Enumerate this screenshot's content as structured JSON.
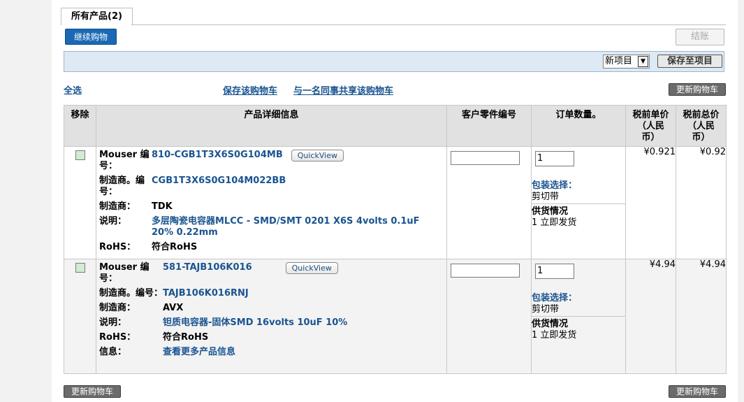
{
  "tab": {
    "label": "所有产品(2)"
  },
  "buttons": {
    "continue_shopping": "继续购物",
    "checkout": "结账",
    "save_project": "保存至项目",
    "update_cart": "更新购物车"
  },
  "project_select": {
    "value": "新项目"
  },
  "links": {
    "select_all": "全选",
    "save_cart": "保存该购物车",
    "share_cart": "与一名同事共享该购物车"
  },
  "table": {
    "headers": {
      "remove": "移除",
      "details": "产品详细信息",
      "customer_part": "客户零件编号",
      "quantity": "订单数量。",
      "unit_price": "税前单价（人民币）",
      "total_price": "税前总价（人民币）"
    },
    "quickview": "QuickView",
    "rows": [
      {
        "mouser_label": "Mouser 编号：",
        "mouser_no": "810-CGB1T3X6S0G104MB",
        "mfr_label": "制造商。编号：",
        "mfr_no": "CGB1T3X6S0G104M022BB",
        "maker_label": "制造商：",
        "maker": "TDK",
        "desc_label": "说明：",
        "desc": "多层陶瓷电容器MLCC - SMD/SMT 0201 X6S 4volts 0.1uF 20% 0.22mm",
        "rohs_label": "RoHS：",
        "rohs": "符合RoHS",
        "qty": "1",
        "pack_label": "包装选择：",
        "pack": "剪切带",
        "stock_label": "供货情况",
        "stock": "1 立即发货",
        "unit": "¥0.921",
        "total": "¥0.92"
      },
      {
        "mouser_label": "Mouser 编号：",
        "mouser_no": "581-TAJB106K016",
        "mfr_label": "制造商。编号：",
        "mfr_no": "TAJB106K016RNJ",
        "maker_label": "制造商：",
        "maker": "AVX",
        "desc_label": "说明：",
        "desc": "钽质电容器-固体SMD 16volts 10uF 10%",
        "rohs_label": "RoHS：",
        "rohs": "符合RoHS",
        "info_label": "信息：",
        "info": "查看更多产品信息",
        "qty": "1",
        "pack_label": "包装选择：",
        "pack": "剪切带",
        "stock_label": "供货情况",
        "stock": "1 立即发货",
        "unit": "¥4.94",
        "total": "¥4.94"
      }
    ]
  },
  "colors": {
    "primary_button": "#1b69b5",
    "link": "#1a5490",
    "project_bar": "#dde9f4"
  }
}
